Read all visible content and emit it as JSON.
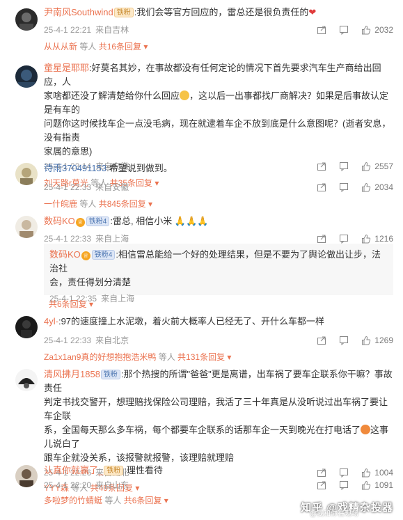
{
  "comments": [
    {
      "user": "尹南风Southwind",
      "badge": "铁粉",
      "text": ":我们会等官方回应的，雷总还是很负责任的",
      "time": "25-4-1 22:21",
      "location": "来自吉林",
      "likes": "2032",
      "reply_user": "从从从新",
      "reply_mid": " 等人 ",
      "reply_more": "共16条回复"
    },
    {
      "user": "童星是耶耶",
      "text_a": ":好莫名其妙，在事故都没有任何定论的情况下首先要求汽车生产商给出回应，人",
      "text_b": "家啥都还没了解清楚给你什么回应",
      "text_c": "，这以后一出事都找厂商解决？如果是后事故认定是有车的",
      "text_d": "问题你这时候找车企一点没毛病，现在就逮着车企不放到底是什么意图呢？(逝者安息，没有指责",
      "text_e": "家属的意思)",
      "time": "25-4-1 23:14",
      "location": "来自安徽",
      "likes": "2557",
      "reply_user": "刘天路r莫光",
      "reply_mid": " 等人 ",
      "reply_more": "共35条回复"
    },
    {
      "user": "诗雨370491153",
      "text": ":希望说到做到。",
      "time": "25-4-1 22:33",
      "location": "来自安徽",
      "likes": "2034",
      "reply_user": "一什皖鹿",
      "reply_mid": " 等人 ",
      "reply_more": "共845条回复"
    },
    {
      "user": "数码KO",
      "badge": "铁粉4",
      "text": ":雷总, 相信小米",
      "time": "25-4-1 22:33",
      "location": "来自上海",
      "likes": "1216",
      "sub_user": "数码KO",
      "sub_badge": "铁粉4",
      "sub_text_a": ":相信雷总能给一个好的处理结果，但是不要为了舆论做出让步，法治社",
      "sub_text_b": "会，责任得划分清楚",
      "sub_time": "25-4-1 22:35",
      "sub_location": "来自上海",
      "reply_more": "共6条回复"
    },
    {
      "user": "4yl-",
      "text": ":97的速度撞上水泥墩，着火前大概率人已经无了、开什么车都一样",
      "time": "25-4-1 22:33",
      "location": "来自北京",
      "likes": "1269",
      "reply_user": "Za1x1an9真的好想抱抱浩米鸭",
      "reply_mid": " 等人 ",
      "reply_more": "共131条回复"
    },
    {
      "user": "清风拂月1858",
      "badge": "铁粉",
      "text_a": ":那个热搜的所谓\"爸爸\"更是离谱，出车祸了要车企联系你干嘛？事故责任",
      "text_b": "判定书找交警开，想理赔找保险公司理赔，我活了三十年真是从没听说过出车祸了要让车企联",
      "text_c": "系，全国每天那么多车祸，每个都要车企联系的话那车企一天到晚光在打电话了",
      "text_d": "这事儿说白了",
      "text_e": "跟车企就没关系，该报警就报警，该理赔就理赔",
      "time": "25-4-1 22:26",
      "location": "来自湖北",
      "likes": "1004",
      "reply_user": "YYY森",
      "reply_mid": " 等人 ",
      "reply_more": "共49条回复"
    },
    {
      "user": "认真你就赢了_",
      "badge": "铁粉",
      "text": ":理性看待",
      "time": "25-4-1 22:20",
      "location": "来自山东",
      "likes": "1091",
      "reply_user": "多啦梦的竹蜻蜓",
      "reply_mid": " 等人 ",
      "reply_more": "共6条回复"
    }
  ],
  "watermark": "知乎 @戏精杂投器",
  "watermark_sub": "@我和你在现场",
  "colors": {
    "name": "#eb7350",
    "meta": "#999999",
    "text": "#333333"
  }
}
